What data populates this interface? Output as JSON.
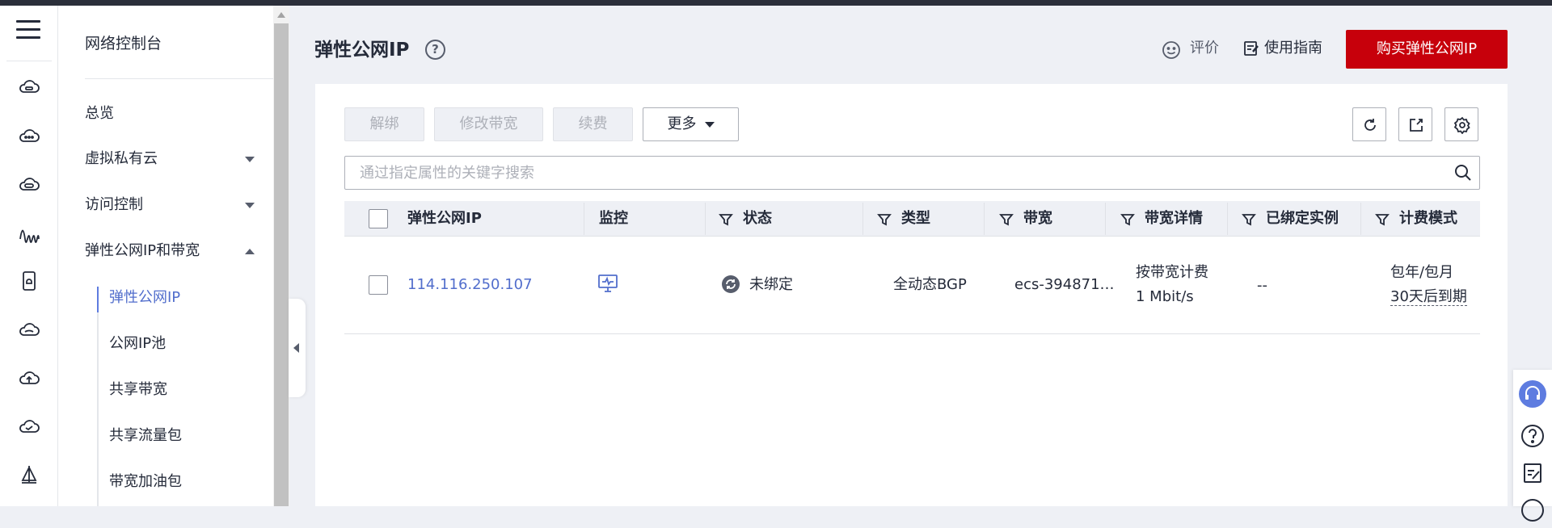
{
  "console_title": "网络控制台",
  "rail_icons": [
    "menu-icon",
    "vpc-cloud-icon",
    "cloud-dots-icon",
    "gateway-icon",
    "wave-icon",
    "device-icon",
    "cloud-icon",
    "cloud-upload-icon",
    "cloud-check-icon",
    "sail-icon"
  ],
  "subnav": {
    "overview": "总览",
    "vpc": "虚拟私有云",
    "access": "访问控制",
    "eip_group": "弹性公网IP和带宽",
    "children": [
      "弹性公网IP",
      "公网IP池",
      "共享带宽",
      "共享流量包",
      "带宽加油包"
    ],
    "active_child": "弹性公网IP"
  },
  "header": {
    "title": "弹性公网IP",
    "help": "?",
    "rate": "评价",
    "guide": "使用指南",
    "buy": "购买弹性公网IP"
  },
  "toolbar": {
    "unbind": "解绑",
    "modify_bw": "修改带宽",
    "renew": "续费",
    "more": "更多"
  },
  "search": {
    "placeholder": "通过指定属性的关键字搜索"
  },
  "table": {
    "columns": [
      "弹性公网IP",
      "监控",
      "状态",
      "类型",
      "带宽",
      "带宽详情",
      "已绑定实例",
      "计费模式"
    ],
    "rows": [
      {
        "ip": "114.116.250.107",
        "status": "未绑定",
        "type": "全动态BGP",
        "bandwidth": "ecs-394871…",
        "bw_detail_1": "按带宽计费",
        "bw_detail_2": "1 Mbit/s",
        "instance": "--",
        "billing_1": "包年/包月",
        "billing_2": "30天后到期"
      }
    ]
  },
  "colors": {
    "brand_red": "#c7000b",
    "link_blue": "#526ecc",
    "accent_blue": "#5e7ce0"
  }
}
